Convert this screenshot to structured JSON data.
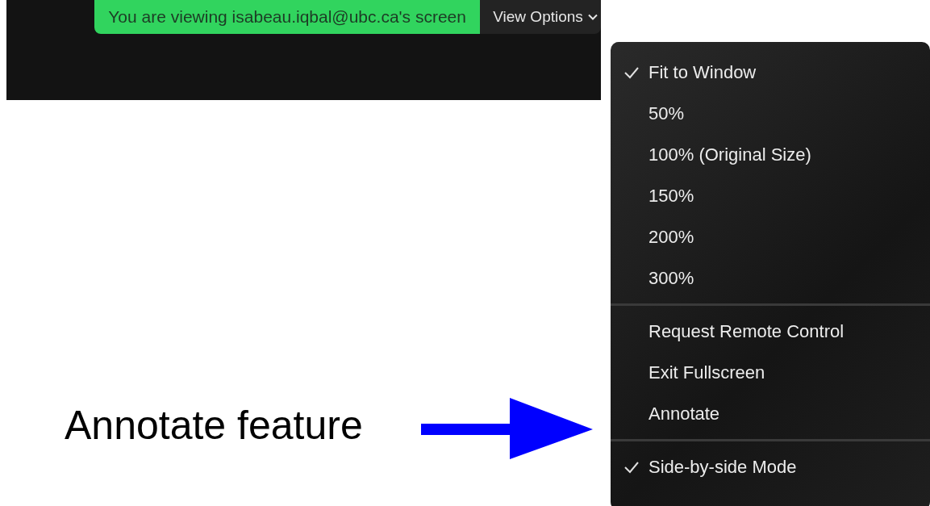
{
  "banner": {
    "text": "You are viewing isabeau.iqbal@ubc.ca's screen"
  },
  "view_options": {
    "label": "View Options",
    "expanded": true
  },
  "menu": {
    "sections": [
      {
        "items": [
          {
            "label": "Fit to Window",
            "checked": true
          },
          {
            "label": "50%",
            "checked": false
          },
          {
            "label": "100% (Original Size)",
            "checked": false
          },
          {
            "label": "150%",
            "checked": false
          },
          {
            "label": "200%",
            "checked": false
          },
          {
            "label": "300%",
            "checked": false
          }
        ]
      },
      {
        "items": [
          {
            "label": "Request Remote Control",
            "checked": false
          },
          {
            "label": "Exit Fullscreen",
            "checked": false
          },
          {
            "label": "Annotate",
            "checked": false
          }
        ]
      },
      {
        "items": [
          {
            "label": "Side-by-side Mode",
            "checked": true
          }
        ]
      }
    ]
  },
  "annotation": {
    "text": "Annotate feature"
  }
}
